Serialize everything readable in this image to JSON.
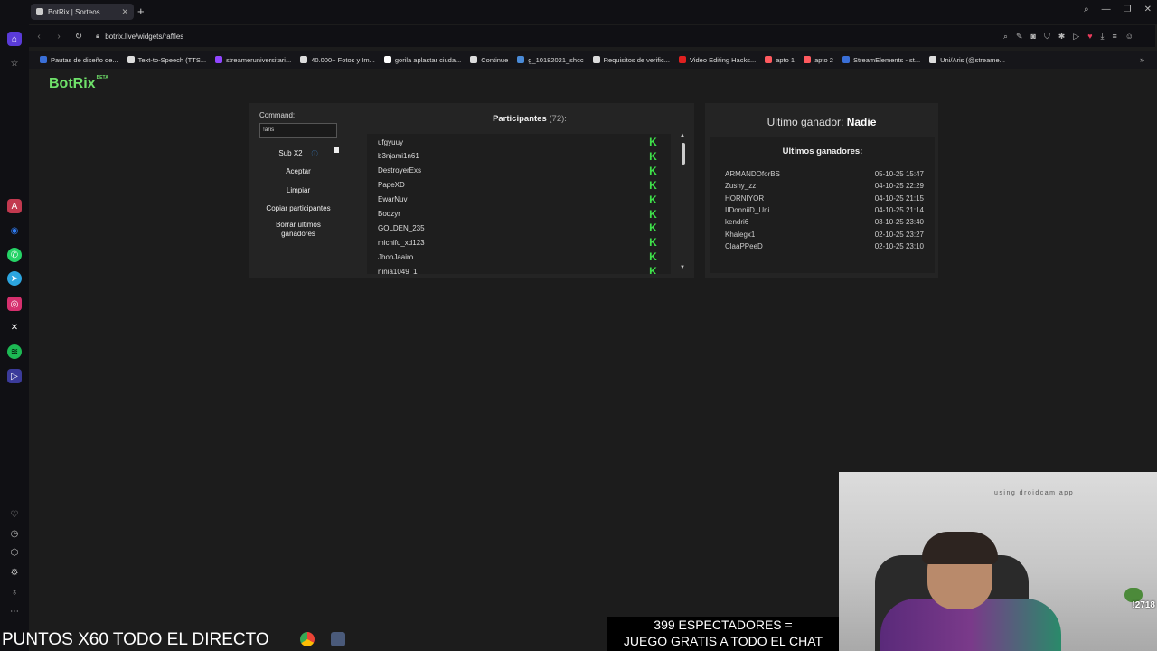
{
  "browser": {
    "tab_title": "BotRix | Sorteos",
    "url": "botrix.live/widgets/raffles",
    "bookmarks": [
      {
        "label": "Pautas de diseño de...",
        "color": "#3a6fd8"
      },
      {
        "label": "Text-to-Speech (TTS...",
        "color": "#dddddd"
      },
      {
        "label": "streameruniversitari...",
        "color": "#9146ff"
      },
      {
        "label": "40.000+ Fotos y Im...",
        "color": "#dddddd"
      },
      {
        "label": "gorila aplastar ciuda...",
        "color": "#ffffff"
      },
      {
        "label": "Continue",
        "color": "#dddddd"
      },
      {
        "label": "g_10182021_shcc",
        "color": "#4a8bd8"
      },
      {
        "label": "Requisitos de verific...",
        "color": "#dddddd"
      },
      {
        "label": "Video Editing Hacks...",
        "color": "#e02020"
      },
      {
        "label": "apto 1",
        "color": "#ff5a5f"
      },
      {
        "label": "apto 2",
        "color": "#ff5a5f"
      },
      {
        "label": "StreamElements - st...",
        "color": "#3a6fd8"
      },
      {
        "label": "Uni/Aris (@streame...",
        "color": "#dddddd"
      }
    ]
  },
  "app": {
    "logo": "BotRix",
    "logo_badge": "BETA"
  },
  "controls": {
    "command_label": "Command:",
    "command_value": "!aris",
    "sub_label": "Sub X2",
    "accept": "Aceptar",
    "clear": "Limpiar",
    "copy": "Copiar participantes",
    "delete_winners": "Borrar ultimos ganadores"
  },
  "participants": {
    "title": "Participantes",
    "count": "(72):",
    "items": [
      "ufgyuuy",
      "b3njami1n61",
      "DestroyerExs",
      "PapeXD",
      "EwarNuv",
      "Boqzyr",
      "GOLDEN_235",
      "michifu_xd123",
      "JhonJaairo",
      "ninja1049_1"
    ]
  },
  "winner": {
    "label": "Ultimo ganador:",
    "name": "Nadie",
    "history_title": "Ultimos ganadores:",
    "history": [
      {
        "name": "ARMANDOforBS",
        "date": "05-10-25 15:47"
      },
      {
        "name": "Zushy_zz",
        "date": "04-10-25 22:29"
      },
      {
        "name": "HORNIYOR",
        "date": "04-10-25 21:15"
      },
      {
        "name": "IIDonniiD_Uni",
        "date": "04-10-25 21:14"
      },
      {
        "name": "kendri6",
        "date": "03-10-25 23:40"
      },
      {
        "name": "Khalegx1",
        "date": "02-10-25 23:27"
      },
      {
        "name": "ClaaPPeeD",
        "date": "02-10-25 23:10"
      }
    ]
  },
  "overlay": {
    "points_text": "PUNTOS X60 TODO EL DIRECTO",
    "spectators_line1": "399 ESPECTADORES =",
    "spectators_line2": "JUEGO GRATIS A TODO EL CHAT",
    "cam_caption": "using droidcam app",
    "cam_badge": "!2718"
  },
  "colors": {
    "accent_green": "#3ee24a",
    "logo_green": "#6fe16a",
    "background": "#1c1c1c",
    "panel": "#242424"
  }
}
